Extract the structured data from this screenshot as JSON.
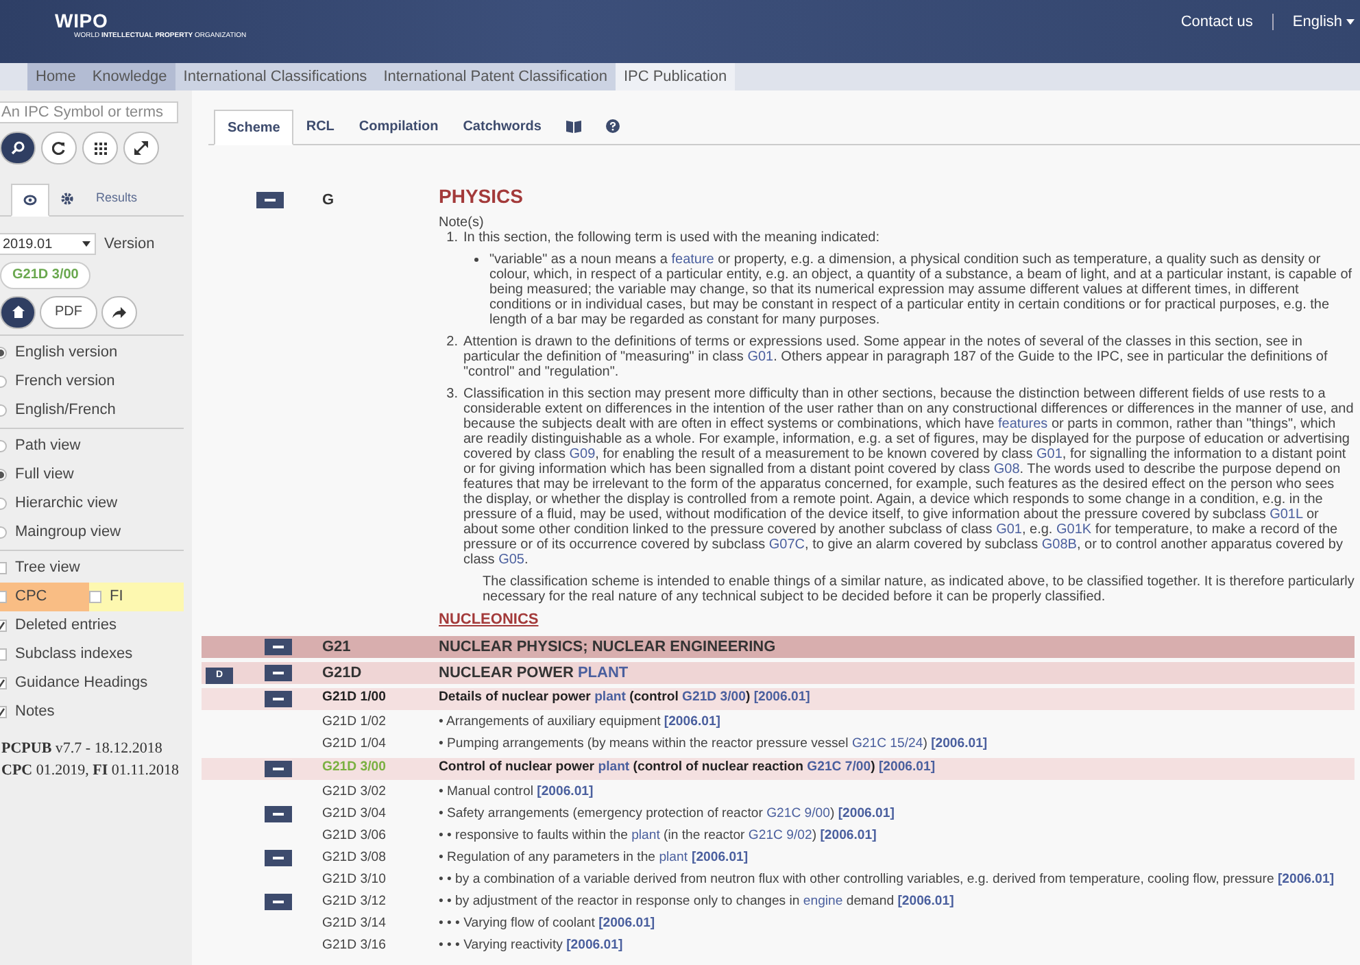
{
  "header": {
    "logo": "WIPO",
    "org": "WORLD **INTELLECTUAL PROPERTY** ORGANIZATION",
    "links": [
      "Contact us",
      "English"
    ]
  },
  "nav": [
    {
      "label": "Home",
      "selected": false
    },
    {
      "label": "Knowledge",
      "selected": false
    },
    {
      "label": "International Classifications",
      "selected": false
    },
    {
      "label": "International Patent Classification",
      "selected": false
    },
    {
      "label": "IPC Publication",
      "selected": true
    }
  ],
  "sidebar": {
    "search": {
      "placeholder": "An IPC Symbol or terms"
    },
    "tabs": [
      {
        "kind": "eye",
        "selected": true
      },
      {
        "kind": "gear",
        "selected": false
      },
      {
        "kind": "text",
        "label": "Results",
        "selected": false
      }
    ],
    "version": {
      "value": "2019.01",
      "label": "Version"
    },
    "symbol": "G21D 3/00",
    "pdf": "PDF",
    "groups": [
      [
        {
          "kind": "radio",
          "label": "English version",
          "selected": true
        },
        {
          "kind": "radio",
          "label": "French version",
          "selected": false
        },
        {
          "kind": "radio",
          "label": "English/French",
          "selected": false
        }
      ],
      [
        {
          "kind": "radio",
          "label": "Path view",
          "selected": false
        },
        {
          "kind": "radio",
          "label": "Full view",
          "selected": true
        },
        {
          "kind": "radio",
          "label": "Hierarchic view",
          "selected": false
        },
        {
          "kind": "radio",
          "label": "Maingroup view",
          "selected": false
        }
      ],
      [
        {
          "kind": "checkbox",
          "label": "Tree view",
          "checked": false
        },
        {
          "kind": "pair",
          "items": [
            {
              "label": "CPC",
              "checked": false,
              "color": "#f9bd84"
            },
            {
              "label": "FI",
              "checked": false,
              "color": "#fdf8b0"
            }
          ]
        },
        {
          "kind": "checkbox",
          "label": "Deleted entries",
          "checked": true
        },
        {
          "kind": "checkbox",
          "label": "Subclass indexes",
          "checked": false
        },
        {
          "kind": "checkbox",
          "label": "Guidance Headings",
          "checked": true
        },
        {
          "kind": "checkbox",
          "label": "Notes",
          "checked": true
        }
      ]
    ],
    "footer": [
      "**PCPUB** v7.7 - 18.12.2018",
      "**CPC** 01.2019, **FI** 01.11.2018"
    ]
  },
  "tabs": [
    {
      "kind": "text",
      "label": "Scheme",
      "selected": true
    },
    {
      "kind": "text",
      "label": "RCL",
      "selected": false
    },
    {
      "kind": "text",
      "label": "Compilation",
      "selected": false
    },
    {
      "kind": "text",
      "label": "Catchwords",
      "selected": false
    },
    {
      "kind": "book",
      "selected": false
    },
    {
      "kind": "help",
      "selected": false
    }
  ],
  "section": {
    "symbol": "G",
    "title": "PHYSICS",
    "notes_label": "Note(s)",
    "notes": [
      {
        "number": "1.",
        "text": [
          "In this section, the following term is used with the meaning indicated:"
        ],
        "bullets": [
          [
            "\"variable\" as a noun means a ",
            {
              "link": "feature"
            },
            " or property, e.g. a dimension, a physical condition such as temperature, a quality such as density or colour, which, in respect of a particular entity, e.g. an object, a quantity of a substance, a beam of light, and at a particular instant, is capable of being measured; the variable may change, so that its numerical expression may assume different values at different times, in different conditions or in individual cases, but may be constant in respect of a particular entity in certain conditions or for practical purposes, e.g. the length of a bar may be regarded as constant for many purposes."
          ]
        ]
      },
      {
        "number": "2.",
        "text": [
          "Attention is drawn to the definitions of terms or expressions used. Some appear in the notes of several of the classes in this section, see in particular the definition of \"measuring\" in class ",
          {
            "link": "G01"
          },
          ". Others appear in paragraph 187 of the Guide to the IPC, see in particular the definitions of \"control\" and \"regulation\"."
        ]
      },
      {
        "number": "3.",
        "text": [
          "Classification in this section may present more difficulty than in other sections, because the distinction between different fields of use rests to a considerable extent on differences in the intention of the user rather than on any constructional differences or differences in the manner of use, and because the subjects dealt with are often in effect systems or combinations, which have ",
          {
            "link": "features"
          },
          " or parts in common, rather than \"things\", which are readily distinguishable as a whole. For example, information, e.g. a set of figures, may be displayed for the purpose of education or advertising covered by class ",
          {
            "link": "G09"
          },
          ", for enabling the result of a measurement to be known covered by class ",
          {
            "link": "G01"
          },
          ", for signalling the information to a distant point or for giving information which has been signalled from a distant point covered by class ",
          {
            "link": "G08"
          },
          ". The words used to describe the purpose depend on features that may be irrelevant to the form of the apparatus concerned, for example, such features as the desired effect on the person who sees the display, or whether the display is controlled from a remote point. Again, a device which responds to some change in a condition, e.g. in the pressure of a fluid, may be used, without modification of the device itself, to give information about the pressure covered by subclass ",
          {
            "link": "G01L"
          },
          " or about some other condition linked to the pressure covered by another subclass of class ",
          {
            "link": "G01"
          },
          ", e.g. ",
          {
            "link": "G01K"
          },
          " for temperature, to make a record of the pressure or of its occurrence covered by subclass ",
          {
            "link": "G07C"
          },
          ", to give an alarm covered by subclass ",
          {
            "link": "G08B"
          },
          ", or to control another apparatus covered by class ",
          {
            "link": "G05"
          },
          "."
        ]
      }
    ],
    "closing": "The classification scheme is intended to enable things of a similar nature, as indicated above, to be classified together. It is therefore particularly necessary for the real nature of any technical subject to be decided before it can be properly classified."
  },
  "heading": "NUCLEONICS",
  "rows": [
    {
      "kind": "class",
      "badge": "",
      "toggle": true,
      "selected": false,
      "symbol": "G21",
      "title": [
        "NUCLEAR PHYSICS; NUCLEAR ENGINEERING"
      ]
    },
    {
      "kind": "subclass",
      "badge": "D",
      "toggle": true,
      "selected": false,
      "symbol": "G21D",
      "title": [
        "NUCLEAR POWER ",
        {
          "link": "PLANT"
        }
      ]
    },
    {
      "kind": "maingroup",
      "badge": "",
      "toggle": true,
      "selected": false,
      "symbol": "G21D 1/00",
      "title": [
        "Details of nuclear power ",
        {
          "link": "plant"
        },
        " (control ",
        {
          "link": "G21D 3/00"
        },
        ") ",
        {
          "ref": "[2006.01]"
        }
      ]
    },
    {
      "kind": "subgroup",
      "badge": "",
      "toggle": false,
      "selected": false,
      "symbol": "G21D 1/02",
      "title": [
        "• Arrangements of auxiliary equipment ",
        {
          "ref": "[2006.01]"
        }
      ]
    },
    {
      "kind": "subgroup",
      "badge": "",
      "toggle": false,
      "selected": false,
      "symbol": "G21D 1/04",
      "title": [
        "• Pumping arrangements (by means within the reactor pressure vessel ",
        {
          "link": "G21C 15/24"
        },
        ") ",
        {
          "ref": "[2006.01]"
        }
      ]
    },
    {
      "kind": "maingroup",
      "badge": "",
      "toggle": true,
      "selected": true,
      "symbol": "G21D 3/00",
      "title": [
        "Control of nuclear power ",
        {
          "link": "plant"
        },
        " (control of nuclear reaction ",
        {
          "link": "G21C 7/00"
        },
        ") ",
        {
          "ref": "[2006.01]"
        }
      ]
    },
    {
      "kind": "subgroup",
      "badge": "",
      "toggle": false,
      "selected": false,
      "symbol": "G21D 3/02",
      "title": [
        "• Manual control ",
        {
          "ref": "[2006.01]"
        }
      ]
    },
    {
      "kind": "subgroup",
      "badge": "",
      "toggle": true,
      "selected": false,
      "symbol": "G21D 3/04",
      "title": [
        "• Safety arrangements (emergency protection of reactor ",
        {
          "link": "G21C 9/00"
        },
        ") ",
        {
          "ref": "[2006.01]"
        }
      ]
    },
    {
      "kind": "subgroup",
      "badge": "",
      "toggle": false,
      "selected": false,
      "symbol": "G21D 3/06",
      "title": [
        "• • responsive to faults within the ",
        {
          "link": "plant"
        },
        " (in the reactor ",
        {
          "link": "G21C 9/02"
        },
        ") ",
        {
          "ref": "[2006.01]"
        }
      ]
    },
    {
      "kind": "subgroup",
      "badge": "",
      "toggle": true,
      "selected": false,
      "symbol": "G21D 3/08",
      "title": [
        "• Regulation of any parameters in the ",
        {
          "link": "plant"
        },
        {
          "ref": "[2006.01]"
        }
      ]
    },
    {
      "kind": "subgroup",
      "badge": "",
      "toggle": false,
      "selected": false,
      "symbol": "G21D 3/10",
      "title": [
        "• • by a combination of a variable derived from neutron flux with other controlling variables, e.g. derived from temperature, cooling flow, pressure ",
        {
          "ref": "[2006.01]"
        }
      ]
    },
    {
      "kind": "subgroup",
      "badge": "",
      "toggle": true,
      "selected": false,
      "symbol": "G21D 3/12",
      "title": [
        "• • by adjustment of the reactor in response only to changes in ",
        {
          "link": "engine"
        },
        " demand ",
        {
          "ref": "[2006.01]"
        }
      ]
    },
    {
      "kind": "subgroup",
      "badge": "",
      "toggle": false,
      "selected": false,
      "symbol": "G21D 3/14",
      "title": [
        "• • • Varying flow of coolant ",
        {
          "ref": "[2006.01]"
        }
      ]
    },
    {
      "kind": "subgroup",
      "badge": "",
      "toggle": false,
      "selected": false,
      "symbol": "G21D 3/16",
      "title": [
        "• • • Varying reactivity ",
        {
          "ref": "[2006.01]"
        }
      ]
    }
  ]
}
